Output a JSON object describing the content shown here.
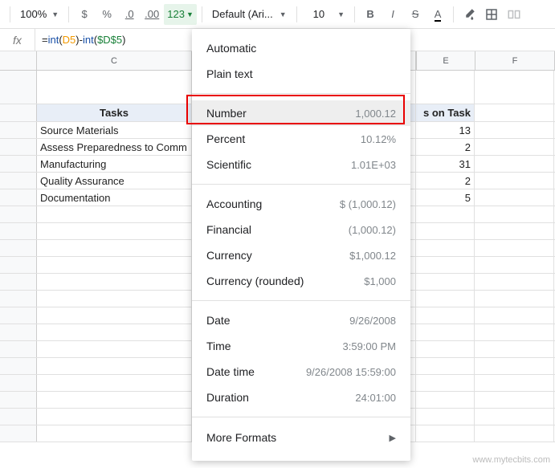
{
  "toolbar": {
    "zoom": "100%",
    "currency": "$",
    "percent": "%",
    "dec_dec": ".0",
    "inc_dec": ".00",
    "format_btn": "123",
    "font": "Default (Ari...",
    "font_size": "10",
    "bold": "B",
    "italic": "I",
    "strike": "S",
    "text_color": "A"
  },
  "formula": {
    "fx": "fx",
    "pre": "=",
    "fn1": "int",
    "open": "(",
    "ref1": "D5",
    "close": ")",
    "minus": "-",
    "fn2": "int",
    "ref2": "$D$5"
  },
  "cols": {
    "C": "C",
    "E": "E",
    "F": "F"
  },
  "sheet": {
    "header": {
      "tasks": "Tasks",
      "days": "s on Task"
    },
    "rows": [
      {
        "task": "Source Materials",
        "days": "13"
      },
      {
        "task": "Assess Preparedness to Comm",
        "days": "2"
      },
      {
        "task": "Manufacturing",
        "days": "31"
      },
      {
        "task": "Quality Assurance",
        "days": "2"
      },
      {
        "task": "Documentation",
        "days": "5"
      }
    ]
  },
  "menu": {
    "automatic": "Automatic",
    "plaintext": "Plain text",
    "number": {
      "label": "Number",
      "ex": "1,000.12"
    },
    "percent": {
      "label": "Percent",
      "ex": "10.12%"
    },
    "scientific": {
      "label": "Scientific",
      "ex": "1.01E+03"
    },
    "accounting": {
      "label": "Accounting",
      "ex": "$ (1,000.12)"
    },
    "financial": {
      "label": "Financial",
      "ex": "(1,000.12)"
    },
    "currency": {
      "label": "Currency",
      "ex": "$1,000.12"
    },
    "currency_r": {
      "label": "Currency (rounded)",
      "ex": "$1,000"
    },
    "date": {
      "label": "Date",
      "ex": "9/26/2008"
    },
    "time": {
      "label": "Time",
      "ex": "3:59:00 PM"
    },
    "datetime": {
      "label": "Date time",
      "ex": "9/26/2008 15:59:00"
    },
    "duration": {
      "label": "Duration",
      "ex": "24:01:00"
    },
    "more": "More Formats"
  },
  "watermark": "www.mytecbits.com"
}
